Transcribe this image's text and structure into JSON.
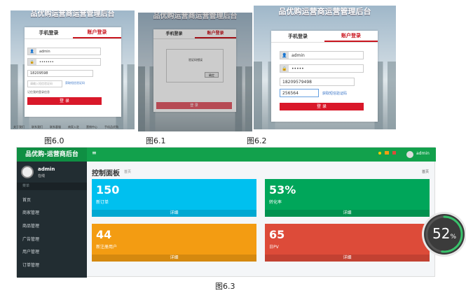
{
  "screens": {
    "s60": {
      "title": "品优购运营商运营管理后台",
      "tab1": "手机登录",
      "tab2": "账户登录",
      "user": "admin",
      "pass": "•••••••",
      "phone": "18209598",
      "code": "请输入短信验证码",
      "code_link": "获取短信验证码",
      "remember": "记住我的登录信息",
      "login": "登 录",
      "footer": [
        "关于我们",
        "联系我们",
        "联系客服",
        "商家入驻",
        "营销中心",
        "手机品优购",
        "销售联盟",
        "品优购社区"
      ],
      "caption": "图6.0"
    },
    "s61": {
      "title": "品优购运营商运营管理后台",
      "tab1": "手机登录",
      "tab2": "账户登录",
      "dialog_text": "验证码错误",
      "dialog_btn": "确定",
      "login": "登 录",
      "caption": "图6.1"
    },
    "s62": {
      "title": "品优购运营商运营管理后台",
      "tab1": "手机登录",
      "tab2": "账户登录",
      "user": "admin",
      "pass": "•••••",
      "phone": "18209579498",
      "code": "256564",
      "code_link": "获取短信验证码",
      "login": "登 录",
      "caption": "图6.2"
    }
  },
  "dashboard": {
    "brand": "品优购-运营商后台",
    "menu_icon": "≡",
    "user": "admin",
    "status": "在线",
    "sidebar_label": "菜单",
    "sidebar_items": [
      "首页",
      "商家管理",
      "商品管理",
      "广告管理",
      "用户管理",
      "订单管理"
    ],
    "title": "控制面板",
    "subtitle": "首页",
    "breadcrumb": "首页",
    "cards": [
      {
        "value": "150",
        "label": "新订单",
        "footer": "详细",
        "color": "#00c0ef"
      },
      {
        "value": "53%",
        "label": "转化率",
        "footer": "详细",
        "color": "#00a65a"
      },
      {
        "value": "44",
        "label": "新注册用户",
        "footer": "详细",
        "color": "#f39c12"
      },
      {
        "value": "65",
        "label": "日PV",
        "footer": "详细",
        "color": "#dd4b39"
      }
    ],
    "caption": "图6.3"
  },
  "ring": {
    "value": "52",
    "unit": "%",
    "level": 0.52
  }
}
